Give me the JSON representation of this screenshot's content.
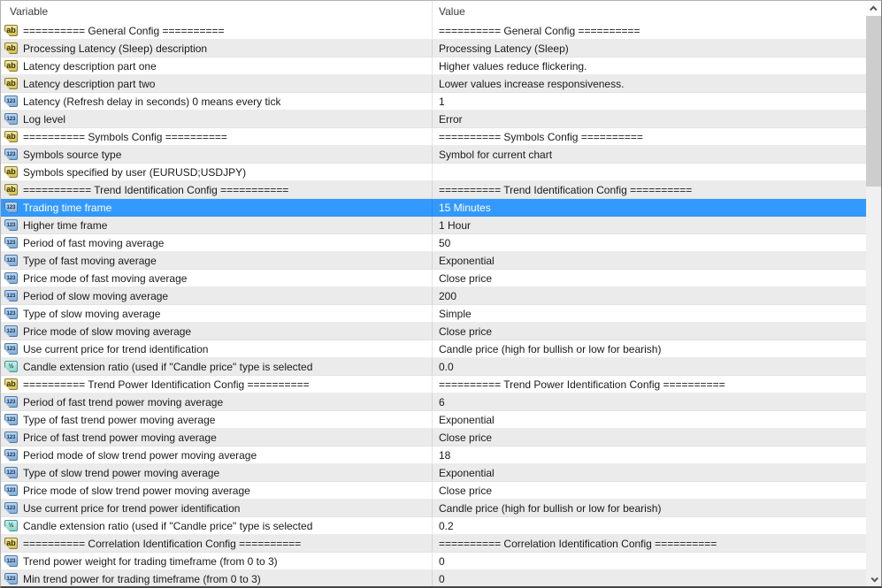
{
  "table": {
    "columns": {
      "variable": "Variable",
      "value": "Value"
    },
    "rows": [
      {
        "type": "string",
        "variable": "========== General Config ==========",
        "value": "========== General Config ==========",
        "selected": false
      },
      {
        "type": "string",
        "variable": "Processing Latency (Sleep) description",
        "value": "Processing Latency (Sleep)",
        "selected": false
      },
      {
        "type": "string",
        "variable": "Latency description part one",
        "value": "Higher values reduce flickering.",
        "selected": false
      },
      {
        "type": "string",
        "variable": "Latency description part two",
        "value": "Lower values increase responsiveness.",
        "selected": false
      },
      {
        "type": "integer",
        "variable": "Latency (Refresh delay in seconds) 0 means every tick",
        "value": "1",
        "selected": false
      },
      {
        "type": "integer",
        "variable": "Log level",
        "value": "Error",
        "selected": false
      },
      {
        "type": "string",
        "variable": "========== Symbols Config ==========",
        "value": "========== Symbols Config ==========",
        "selected": false
      },
      {
        "type": "integer",
        "variable": "Symbols source type",
        "value": "Symbol for current chart",
        "selected": false
      },
      {
        "type": "string",
        "variable": "Symbols specified by user (EURUSD;USDJPY)",
        "value": "",
        "selected": false
      },
      {
        "type": "string",
        "variable": "=========== Trend Identification Config ===========",
        "value": "========== Trend Identification Config ==========",
        "selected": false
      },
      {
        "type": "integer",
        "variable": "Trading time frame",
        "value": "15 Minutes",
        "selected": true
      },
      {
        "type": "integer",
        "variable": "Higher time frame",
        "value": "1 Hour",
        "selected": false
      },
      {
        "type": "integer",
        "variable": "Period of fast moving average",
        "value": "50",
        "selected": false
      },
      {
        "type": "integer",
        "variable": "Type of fast moving average",
        "value": "Exponential",
        "selected": false
      },
      {
        "type": "integer",
        "variable": "Price mode of fast moving average",
        "value": "Close price",
        "selected": false
      },
      {
        "type": "integer",
        "variable": "Period of slow moving average",
        "value": "200",
        "selected": false
      },
      {
        "type": "integer",
        "variable": "Type of slow moving average",
        "value": "Simple",
        "selected": false
      },
      {
        "type": "integer",
        "variable": "Price mode of slow moving average",
        "value": "Close price",
        "selected": false
      },
      {
        "type": "integer",
        "variable": "Use current price for trend identification",
        "value": "Candle price (high for bullish or low for bearish)",
        "selected": false
      },
      {
        "type": "double",
        "variable": "Candle extension ratio (used if \"Candle price\" type is selected",
        "value": "0.0",
        "selected": false
      },
      {
        "type": "string",
        "variable": "========== Trend Power Identification Config ==========",
        "value": "========== Trend Power Identification Config ==========",
        "selected": false
      },
      {
        "type": "integer",
        "variable": "Period of fast trend power moving average",
        "value": "6",
        "selected": false
      },
      {
        "type": "integer",
        "variable": "Type of fast trend power moving average",
        "value": "Exponential",
        "selected": false
      },
      {
        "type": "integer",
        "variable": "Price of fast trend power moving average",
        "value": "Close price",
        "selected": false
      },
      {
        "type": "integer",
        "variable": "Period mode of slow trend power moving average",
        "value": "18",
        "selected": false
      },
      {
        "type": "integer",
        "variable": "Type of slow trend power moving average",
        "value": "Exponential",
        "selected": false
      },
      {
        "type": "integer",
        "variable": "Price mode of slow trend power moving average",
        "value": "Close price",
        "selected": false
      },
      {
        "type": "integer",
        "variable": "Use current price for trend power identification",
        "value": "Candle price (high for bullish or low for bearish)",
        "selected": false
      },
      {
        "type": "double",
        "variable": "Candle extension ratio (used if \"Candle price\" type is selected",
        "value": "0.2",
        "selected": false
      },
      {
        "type": "string",
        "variable": "========== Correlation Identification Config ==========",
        "value": "========== Correlation Identification Config ==========",
        "selected": false
      },
      {
        "type": "integer",
        "variable": "Trend power weight for trading timeframe (from 0 to 3)",
        "value": "0",
        "selected": false
      },
      {
        "type": "integer",
        "variable": "Min trend power for trading timeframe (from 0 to 3)",
        "value": "0",
        "selected": false
      }
    ]
  },
  "icons": {
    "string": "ab",
    "integer": "123",
    "double": "½"
  },
  "colors": {
    "selection_background": "#3399ff",
    "selection_text": "#ffffff",
    "row_alternate_background": "#ebebeb",
    "icon_string_fill": "#d9c65f",
    "icon_integer_fill": "#9cc0e4",
    "icon_double_fill": "#9fdcd6",
    "scrollbar_thumb": "#cdcdcd",
    "scrollbar_track": "#f0f0f0"
  }
}
